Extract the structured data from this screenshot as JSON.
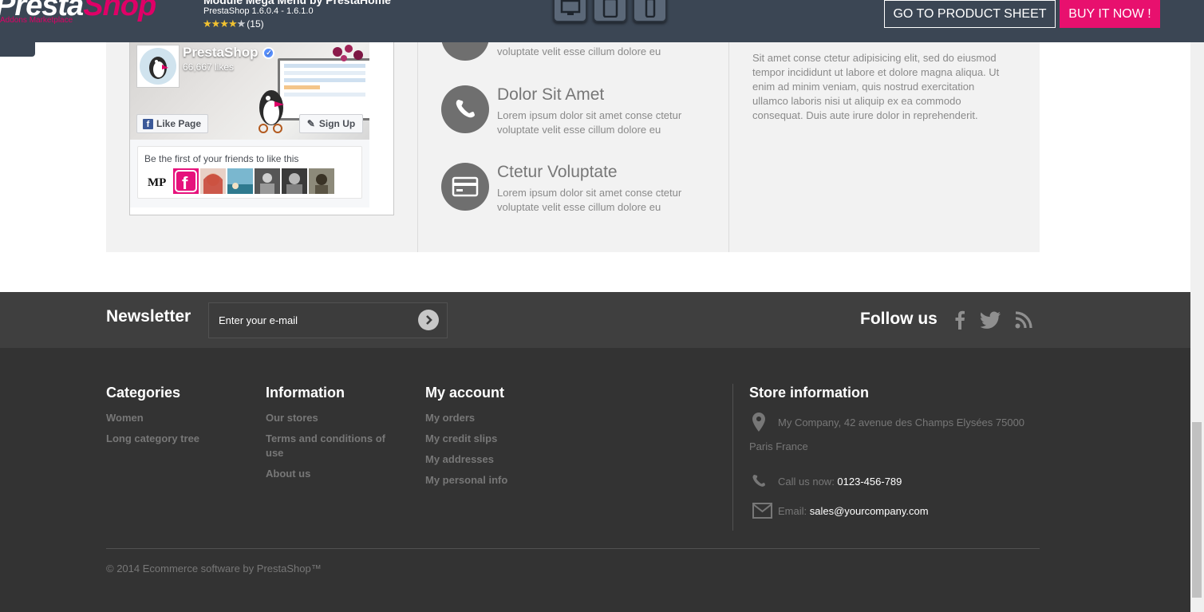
{
  "topbar": {
    "logo_main": "Presta",
    "logo_accent": "Shop",
    "logo_sub": "Addons Marketplace",
    "module_name": "Module Mega Menu by PrestaHome",
    "module_version": "PrestaShop 1.6.0.4 - 1.6.1.0",
    "rating": 4,
    "rating_count": "(15)",
    "devices": [
      "desktop-icon",
      "tablet-icon",
      "mobile-icon"
    ],
    "product_sheet_button": "GO TO PRODUCT SHEET",
    "buy_button": "BUY IT NOW !",
    "colors": {
      "bar": "#3b4654",
      "accent": "#e8106e"
    }
  },
  "facebook": {
    "page_name": "PrestaShop",
    "likes": "66,667 likes",
    "like_button": "Like Page",
    "signup_button": "Sign Up",
    "friends_text": "Be the first of your friends to like this"
  },
  "features": [
    {
      "title": "",
      "text": "voluptate velit esse cillum dolore eu",
      "icon": "partial-icon"
    },
    {
      "title": "Dolor Sit Amet",
      "text": "Lorem ipsum dolor sit amet conse ctetur voluptate velit esse cillum dolore eu",
      "icon": "phone-icon"
    },
    {
      "title": "Ctetur Voluptate",
      "text": "Lorem ipsum dolor sit amet conse ctetur voluptate velit esse cillum dolore eu",
      "icon": "credit-card-icon"
    }
  ],
  "right_text": "Sit amet conse ctetur adipisicing elit, sed do eiusmod tempor incididunt ut labore et dolore magna aliqua. Ut enim ad minim veniam, quis nostrud exercitation ullamco laboris nisi ut aliquip ex ea commodo consequat. Duis aute irure dolor in reprehenderit.",
  "newsletter": {
    "title": "Newsletter",
    "placeholder": "Enter your e-mail",
    "follow_title": "Follow us",
    "social": [
      "facebook-icon",
      "twitter-icon",
      "rss-icon"
    ]
  },
  "footer": {
    "columns": [
      {
        "title": "Categories",
        "links": [
          "Women",
          "Long category tree"
        ]
      },
      {
        "title": "Information",
        "links": [
          "Our stores",
          "Terms and conditions of use",
          "About us"
        ]
      },
      {
        "title": "My account",
        "links": [
          "My orders",
          "My credit slips",
          "My addresses",
          "My personal info"
        ]
      }
    ],
    "store": {
      "title": "Store information",
      "address": "My Company, 42 avenue des Champs Elysées 75000 Paris France",
      "call_label": "Call us now: ",
      "phone": "0123-456-789",
      "email_label": "Email: ",
      "email": "sales@yourcompany.com"
    },
    "copyright": "© 2014 Ecommerce software by PrestaShop™"
  }
}
